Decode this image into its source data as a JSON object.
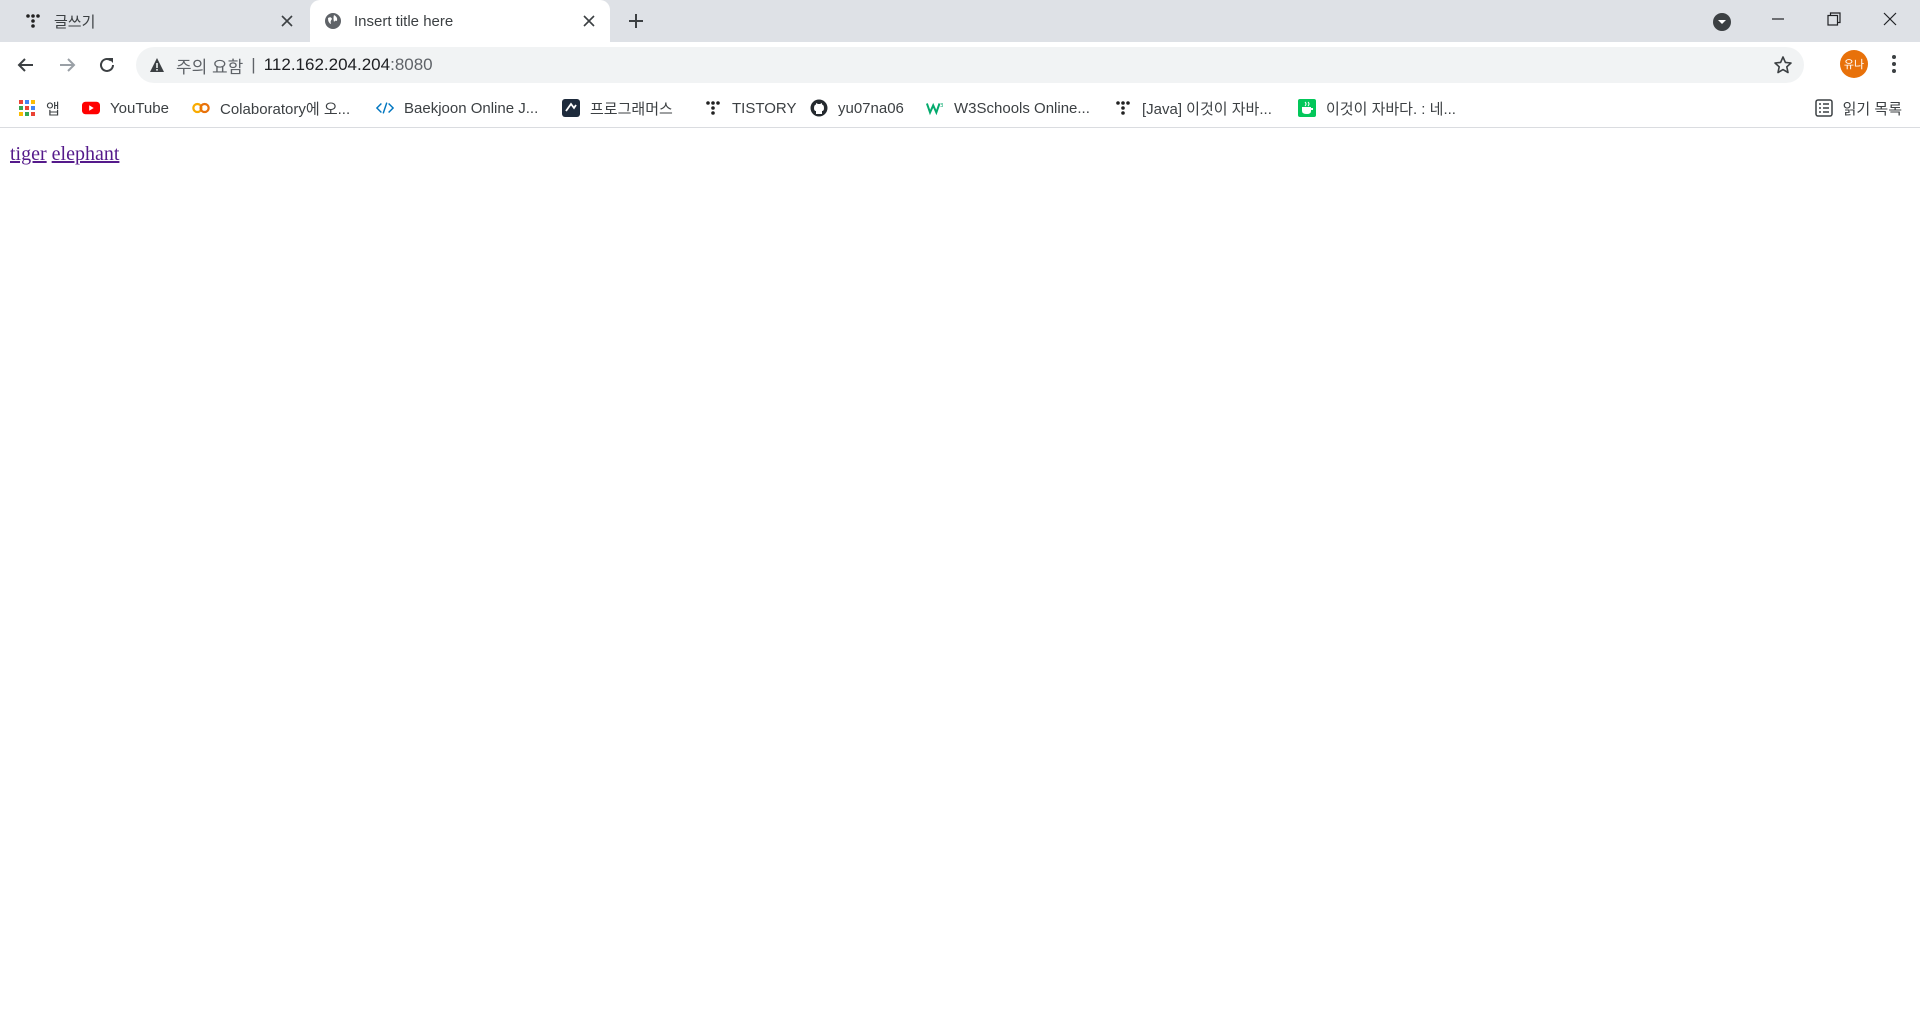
{
  "tabs": [
    {
      "title": "글쓰기",
      "icon": "tistory-icon",
      "active": false
    },
    {
      "title": "Insert title here",
      "icon": "globe-icon",
      "active": true
    }
  ],
  "toolbar": {
    "security_label": "주의 요함",
    "separator": "|",
    "url_host": "112.162.204.204",
    "url_port": ":8080",
    "avatar_text": "유나"
  },
  "bookmarks": [
    {
      "label": "앱",
      "icon": "apps-grid-icon"
    },
    {
      "label": "YouTube",
      "icon": "youtube-icon"
    },
    {
      "label": "Colaboratory에 오...",
      "icon": "colab-icon"
    },
    {
      "label": "Baekjoon Online J...",
      "icon": "baekjoon-icon"
    },
    {
      "label": "프로그래머스",
      "icon": "programmers-icon"
    },
    {
      "label": "TISTORY",
      "icon": "tistory-icon"
    },
    {
      "label": "yu07na06",
      "icon": "github-icon"
    },
    {
      "label": "W3Schools Online...",
      "icon": "w3schools-icon"
    },
    {
      "label": "[Java] 이것이 자바...",
      "icon": "tistory-icon"
    },
    {
      "label": "이것이 자바다. : 네...",
      "icon": "naver-cafe-icon"
    }
  ],
  "reading_list": {
    "label": "읽기 목록",
    "icon": "reading-list-icon"
  },
  "content": {
    "links": [
      "tiger",
      "elephant"
    ]
  },
  "colors": {
    "tabstrip_bg": "#dee1e6",
    "avatar_bg": "#e8710a",
    "visited_link": "#551a8b"
  }
}
